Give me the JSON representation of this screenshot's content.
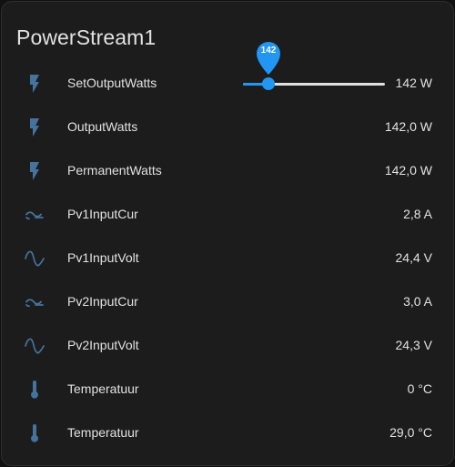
{
  "card": {
    "title": "PowerStream1"
  },
  "colors": {
    "icon": "#44739e",
    "accent": "#2196f3",
    "track": "#e0e0e0"
  },
  "slider": {
    "value": 142,
    "min": 0,
    "max": 800,
    "pin_label": "142"
  },
  "rows": [
    {
      "icon": "flash-icon",
      "name": "SetOutputWatts",
      "value": "142 W"
    },
    {
      "icon": "flash-icon",
      "name": "OutputWatts",
      "value": "142,0 W"
    },
    {
      "icon": "flash-icon",
      "name": "PermanentWatts",
      "value": "142,0 W"
    },
    {
      "icon": "current-ac-icon",
      "name": "Pv1InputCur",
      "value": "2,8 A"
    },
    {
      "icon": "sine-wave-icon",
      "name": "Pv1InputVolt",
      "value": "24,4 V"
    },
    {
      "icon": "current-ac-icon",
      "name": "Pv2InputCur",
      "value": "3,0 A"
    },
    {
      "icon": "sine-wave-icon",
      "name": "Pv2InputVolt",
      "value": "24,3 V"
    },
    {
      "icon": "thermometer-icon",
      "name": "Temperatuur",
      "value": "0 °C"
    },
    {
      "icon": "thermometer-icon",
      "name": "Temperatuur",
      "value": "29,0 °C"
    }
  ]
}
